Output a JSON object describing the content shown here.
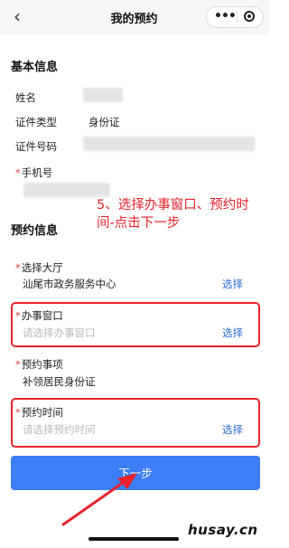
{
  "header": {
    "title": "我的预约",
    "more_icon": "more-dots-icon",
    "close_icon": "target-circle-icon"
  },
  "basic_info": {
    "section_title": "基本信息",
    "name_label": "姓名",
    "id_type_label": "证件类型",
    "id_type_value": "身份证",
    "id_number_label": "证件号码",
    "phone_label": "手机号",
    "required_mark": "*"
  },
  "booking_info": {
    "section_title": "预约信息",
    "hall_label": "选择大厅",
    "hall_value": "汕尾市政务服务中心",
    "window_label": "办事窗口",
    "window_placeholder": "请选择办事窗口",
    "item_label": "预约事项",
    "item_value": "补领居民身份证",
    "time_label": "预约时间",
    "time_placeholder": "请选择预约时间",
    "choose_label": "选择",
    "required_mark": "*"
  },
  "annotation": {
    "text": "5、选择办事窗口、预约时间-点击下一步",
    "color": "#e8232b"
  },
  "footer": {
    "next_button_label": "下一步",
    "watermark": "husay.cn"
  },
  "colors": {
    "accent": "#3d7df5",
    "link": "#2f6bd6",
    "highlight": "#e8232b"
  }
}
